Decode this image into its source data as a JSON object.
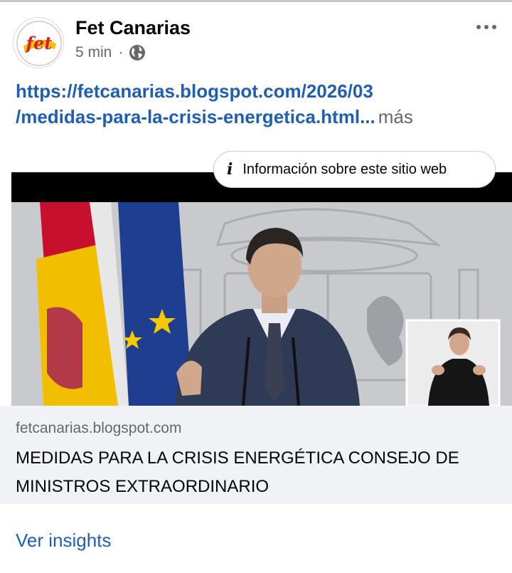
{
  "post": {
    "page_name": "Fet Canarias",
    "timestamp": "5 min",
    "separator": "·",
    "audience_icon": "globe-icon",
    "more_icon": "more-options-icon",
    "link_line1": "https://fetcanarias.blogspot.com/2026/03",
    "link_line2": "/medidas-para-la-crisis-energetica.html",
    "ellipsis": "...",
    "more_label": "más"
  },
  "avatar": {
    "logo_text": "fet"
  },
  "info_pill": {
    "icon": "info-icon",
    "label": "Información sobre este sitio web"
  },
  "link_card": {
    "domain": "fetcanarias.blogspot.com",
    "title": "MEDIDAS PARA LA CRISIS ENERGÉTICA CONSEJO DE MINISTROS EXTRAORDINARIO"
  },
  "actions": {
    "insights_label": "Ver insights"
  },
  "colors": {
    "link": "#1e5fb3",
    "secondary_text": "#65676b",
    "card_bg": "#f0f2f5",
    "logo_red": "#d42027",
    "logo_yellow": "#f6c200"
  }
}
